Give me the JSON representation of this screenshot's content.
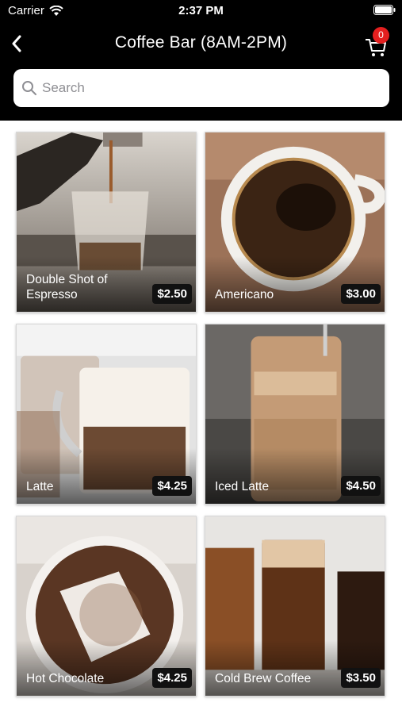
{
  "status_bar": {
    "carrier": "Carrier",
    "time": "2:37 PM"
  },
  "nav": {
    "title": "Coffee Bar (8AM-2PM)",
    "cart_count": "0"
  },
  "search": {
    "placeholder": "Search"
  },
  "products": [
    {
      "name": "Double Shot of Espresso",
      "price": "$2.50"
    },
    {
      "name": "Americano",
      "price": "$3.00"
    },
    {
      "name": "Latte",
      "price": "$4.25"
    },
    {
      "name": "Iced Latte",
      "price": "$4.50"
    },
    {
      "name": "Hot Chocolate",
      "price": "$4.25"
    },
    {
      "name": "Cold Brew Coffee",
      "price": "$3.50"
    }
  ],
  "colors": {
    "header_bg": "#000000",
    "badge": "#e41f1f",
    "price_bg": "#111111"
  }
}
